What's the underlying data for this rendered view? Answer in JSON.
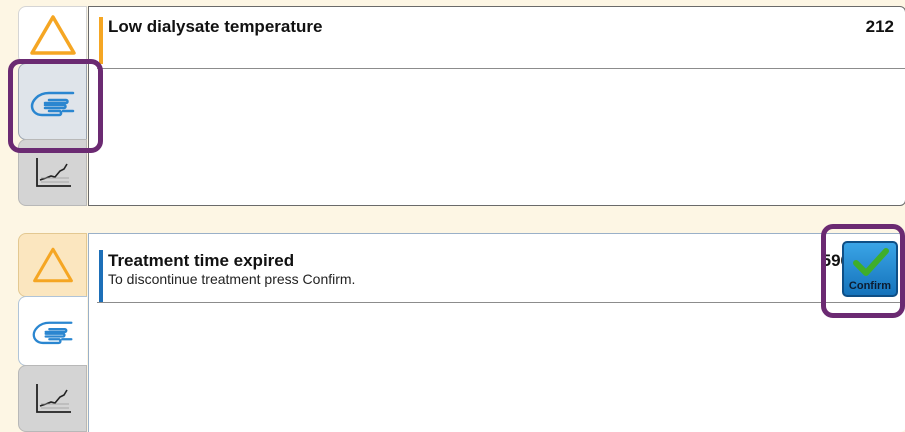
{
  "alarms": [
    {
      "title": "Low dialysate temperature",
      "message": "",
      "code": "212"
    },
    {
      "title": "Treatment time expired",
      "message": "To discontinue treatment press Confirm.",
      "code": "596",
      "action_label": "Confirm"
    }
  ],
  "tabs": {
    "warning_icon": "warning-triangle-icon",
    "hand_icon": "hand-icon",
    "chart_icon": "trend-chart-icon"
  },
  "colors": {
    "background": "#fdf6e4",
    "warning_orange": "#f5a623",
    "alarm_blue_bar": "#1d6fb8",
    "confirm_blue": "#1f86d0",
    "check_green": "#3fae2a",
    "highlight_purple": "#6b2a72",
    "hand_blue": "#2a86d0"
  }
}
